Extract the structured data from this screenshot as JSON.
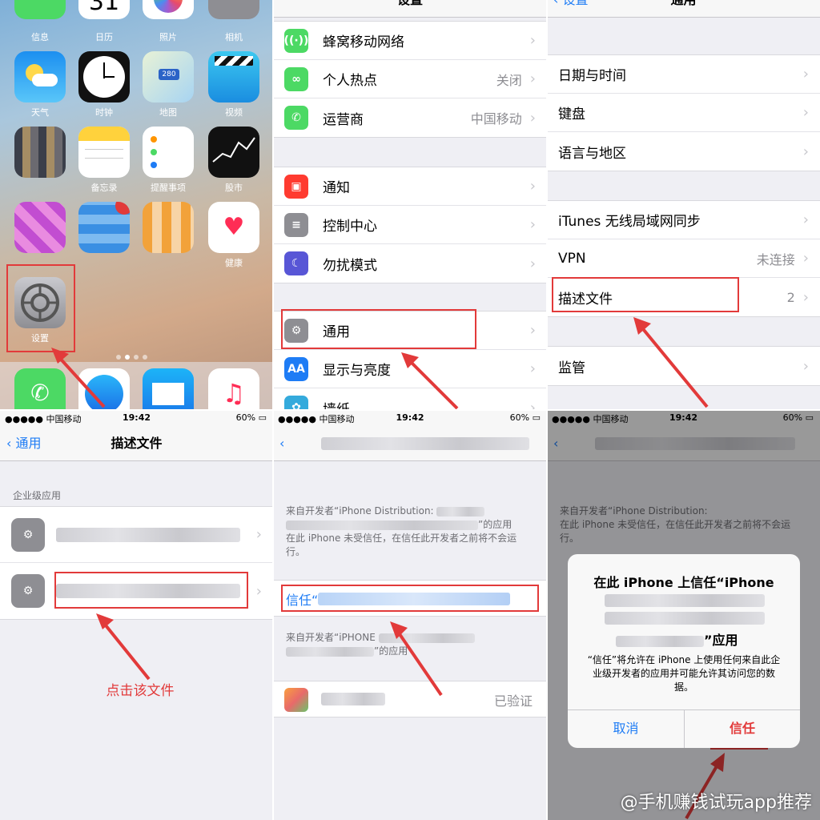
{
  "home": {
    "apps_top": [
      "信息",
      "日历",
      "照片",
      "相机"
    ],
    "apps_row2": [
      "天气",
      "时钟",
      "地图",
      "视频"
    ],
    "apps_row3": [
      "",
      "备忘录",
      "提醒事项",
      "股市"
    ],
    "apps_row4": [
      "",
      "",
      "",
      "健康"
    ],
    "settings_label": "设置",
    "calendar_day": "31",
    "maps_badge": "280"
  },
  "settings": {
    "title": "设置",
    "group1": [
      {
        "label": "蜂窝移动网络",
        "value": ""
      },
      {
        "label": "个人热点",
        "value": "关闭"
      },
      {
        "label": "运营商",
        "value": "中国移动"
      }
    ],
    "group2": [
      {
        "label": "通知",
        "value": ""
      },
      {
        "label": "控制中心",
        "value": ""
      },
      {
        "label": "勿扰模式",
        "value": ""
      }
    ],
    "group3": [
      {
        "label": "通用",
        "value": ""
      },
      {
        "label": "显示与亮度",
        "value": ""
      },
      {
        "label": "墙纸",
        "value": ""
      }
    ]
  },
  "general": {
    "back": "设置",
    "title": "通用",
    "group1": [
      "日期与时间",
      "键盘",
      "语言与地区"
    ],
    "group2": [
      {
        "label": "iTunes 无线局域网同步",
        "value": ""
      },
      {
        "label": "VPN",
        "value": "未连接"
      },
      {
        "label": "描述文件",
        "value": "2"
      }
    ],
    "group3": [
      "监管"
    ]
  },
  "status": {
    "carrier": "●●●●● 中国移动",
    "time": "19:42",
    "battery": "60%"
  },
  "profiles": {
    "back": "通用",
    "title": "描述文件",
    "section": "企业级应用",
    "hint": "点击该文件"
  },
  "developer": {
    "note1a": "来自开发者“iPhone Distribution:",
    "note1b": "”的应用",
    "note1c": "在此 iPhone 未受信任，在信任此开发者之前将不会运行。",
    "trust_link": "信任“",
    "note2a": "来自开发者“iPHONE",
    "note2b": "”的应用",
    "verified": "已验证"
  },
  "alert": {
    "title_line1": "在此 iPhone 上信任“iPhone",
    "title_end": "”应用",
    "message": "“信任”将允许在 iPhone 上使用任何来自此企业级开发者的应用并可能允许其访问您的数据。",
    "cancel": "取消",
    "trust": "信任"
  },
  "watermark": "@手机赚钱试玩app推荐",
  "colors": {
    "ios_blue": "#1e7cf5",
    "highlight_red": "#e23a3a",
    "cellular_green": "#4cd964",
    "notify_red": "#ff3b30",
    "dnd_purple": "#5856d6"
  }
}
